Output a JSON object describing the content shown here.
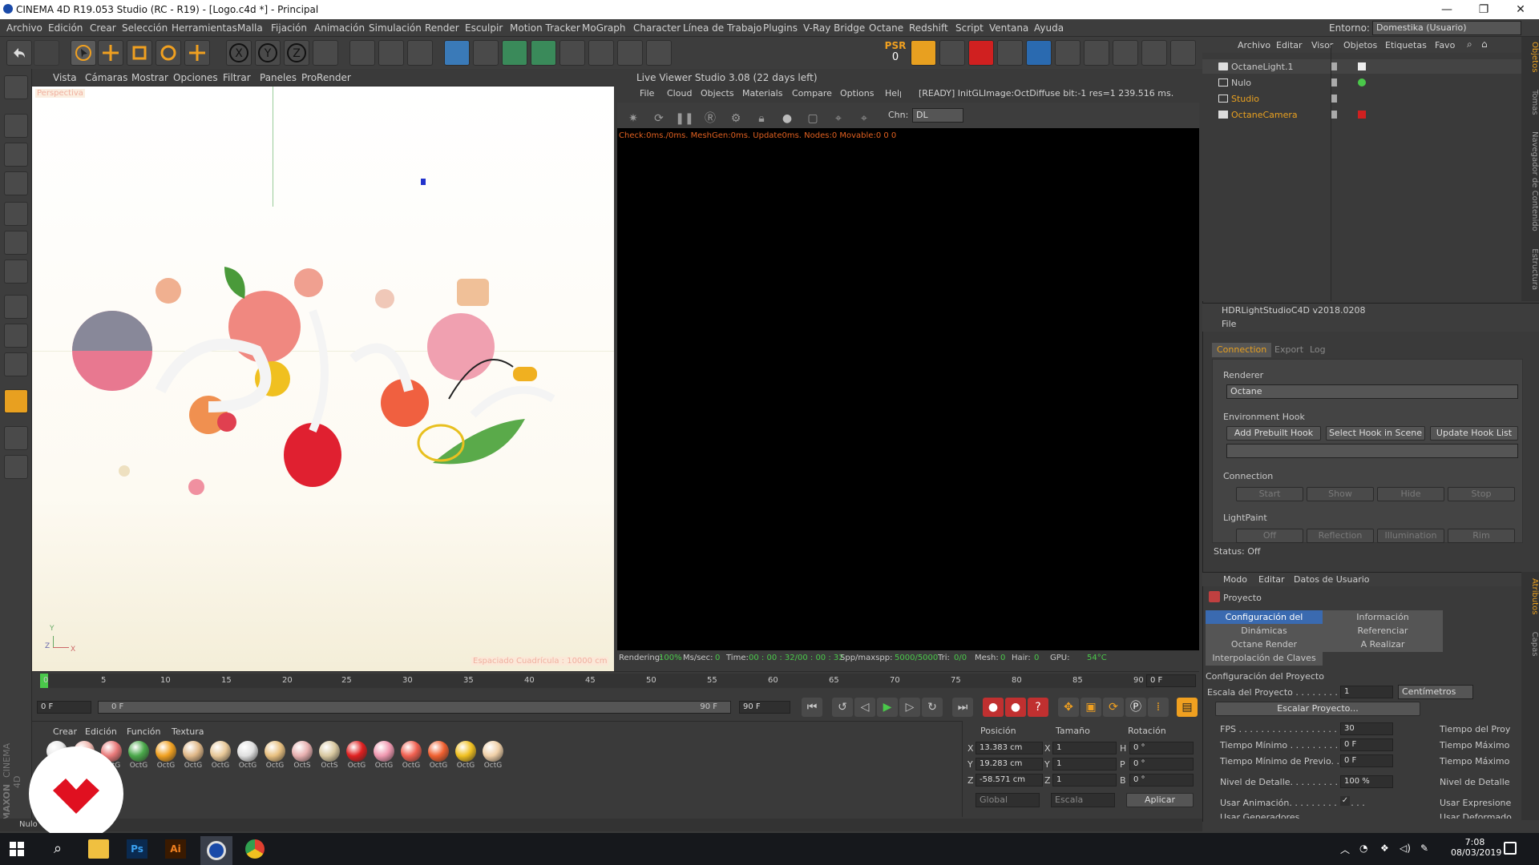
{
  "window": {
    "title": "CINEMA 4D R19.053 Studio (RC - R19) - [Logo.c4d *] - Principal",
    "minimize": "—",
    "maximize": "❐",
    "close": "✕"
  },
  "menubar": {
    "items": [
      "Archivo",
      "Edición",
      "Crear",
      "Selección",
      "Herramientas",
      "Malla",
      "Fijación",
      "Animación",
      "Simulación",
      "Render",
      "Esculpir",
      "Motion Tracker",
      "MoGraph",
      "Character",
      "Línea de Trabajo",
      "Plugins",
      "V-Ray Bridge",
      "Octane",
      "Redshift",
      "Script",
      "Ventana",
      "Ayuda"
    ],
    "env_label": "Entorno:",
    "env_value": "Domestika (Usuario)"
  },
  "toolbar": {
    "psr_label": "PSR",
    "psr_value": "0"
  },
  "viewport": {
    "menu": [
      "Vista",
      "Cámaras",
      "Mostrar",
      "Opciones",
      "Filtrar",
      "Paneles",
      "ProRender"
    ],
    "camera_label": "Perspectiva",
    "grid_label": "Espaciado Cuadrícula : 10000 cm",
    "axis_z": "Z",
    "axis_x": "X",
    "axis_y": "Y"
  },
  "liveviewer": {
    "title": "Live Viewer Studio 3.08 (22 days left)",
    "menu": [
      "File",
      "Cloud",
      "Objects",
      "Materials",
      "Compare",
      "Options",
      "Help"
    ],
    "status_msg": "[READY] InitGLImage:OctDiffuse  bit:-1 res=1  239.516 ms.",
    "chn_label": "Chn:",
    "chn_value": "DL",
    "check_line": "Check:0ms./0ms. MeshGen:0ms. Update0ms. Nodes:0 Movable:0  0 0",
    "bottom": {
      "rendering_label": "Rendering:",
      "rendering_value": "100%",
      "mssec_label": "Ms/sec:",
      "mssec_value": "0",
      "time_label": "Time:",
      "time_value": "00 : 00 : 32/00 : 00 : 32",
      "spp_label": "Spp/maxspp:",
      "spp_value": "5000/5000",
      "tri_label": "Tri:",
      "tri_value": "0/0",
      "mesh_label": "Mesh:",
      "mesh_value": "0",
      "hair_label": "Hair:",
      "hair_value": "0",
      "gpu_label": "GPU:",
      "gpu_value": "54°C"
    }
  },
  "objects": {
    "menu": [
      "Archivo",
      "Editar",
      "Visor",
      "Objetos",
      "Etiquetas",
      "Favo"
    ],
    "items": [
      {
        "name": "OctaneLight.1",
        "color": "#d0d0d0"
      },
      {
        "name": "Nulo",
        "color": "#d0d0d0"
      },
      {
        "name": "Studio",
        "color": "#e8a020"
      },
      {
        "name": "OctaneCamera",
        "color": "#e8a020"
      }
    ],
    "side_tabs": [
      "Objetos",
      "Tomas",
      "Navegador de Contenido",
      "Estructura"
    ]
  },
  "hdr": {
    "title": "HDRLightStudioC4D v2018.0208",
    "file_menu": "File",
    "tabs": [
      "Connection",
      "Export",
      "Log"
    ],
    "renderer_label": "Renderer",
    "renderer_value": "Octane",
    "env_hook_label": "Environment Hook",
    "hook_buttons": [
      "Add Prebuilt Hook",
      "Select Hook in Scene",
      "Update Hook List"
    ],
    "connection_label": "Connection",
    "connection_buttons": [
      "Start",
      "Show",
      "Hide",
      "Stop"
    ],
    "lightpaint_label": "LightPaint",
    "lightpaint_buttons": [
      "Off",
      "Reflection",
      "Illumination",
      "Rim"
    ],
    "status": "Status: Off"
  },
  "attributes": {
    "menu": [
      "Modo",
      "Editar",
      "Datos de Usuario"
    ],
    "proyecto": "Proyecto",
    "tabs": [
      "Configuración del Proyecto",
      "Información",
      "Dinámicas",
      "Referenciar",
      "Octane Render",
      "A Realizar",
      "Interpolación de Claves"
    ],
    "section_title": "Configuración del Proyecto",
    "escala_label": "Escala del Proyecto . . . . . . . . . .",
    "escala_value": "1",
    "escala_unit": "Centímetros",
    "escalar_button": "Escalar Proyecto...",
    "fps_label": "FPS . . . . . . . . . . . . . . . . . . . . . . .",
    "fps_value": "30",
    "tproy_label": "Tiempo del Proy",
    "tmin_label": "Tiempo Mínimo . . . . . . . . . . . . .",
    "tmin_value": "0 F",
    "tmax_label": "Tiempo Máximo",
    "tminprev_label": "Tiempo Mínimo de Previo. . . . . .",
    "tminprev_value": "0 F",
    "tmax2_label": "Tiempo Máximo",
    "nivel_label": "Nivel de Detalle. . . . . . . . . . . . .",
    "nivel_value": "100 %",
    "nivel2_label": "Nivel de Detalle",
    "usar_anim_label": "Usar Animación. . . . . . . . . . . . . .",
    "usar_expr_label": "Usar Expresione",
    "usar_gen_label": "Usar Generadores",
    "usar_def_label": "Usar Deformado",
    "side_tabs": [
      "Atributos",
      "Capas"
    ]
  },
  "timeline": {
    "ticks": [
      "0",
      "5",
      "10",
      "15",
      "20",
      "25",
      "30",
      "35",
      "40",
      "45",
      "50",
      "55",
      "60",
      "65",
      "70",
      "75",
      "80",
      "85",
      "90"
    ],
    "frame_end_field": "0 F",
    "start_field": "0 F",
    "range_left": "0 F",
    "range_right": "90 F",
    "end_field": "90 F"
  },
  "materials": {
    "menu": [
      "Crear",
      "Edición",
      "Función",
      "Textura"
    ],
    "items": [
      {
        "name": "OctG",
        "color": "#e8e8e8"
      },
      {
        "name": "OctG",
        "color": "#f0b8b0"
      },
      {
        "name": "OctG",
        "color": "#e87878"
      },
      {
        "name": "OctG",
        "color": "#4aa84a"
      },
      {
        "name": "OctG",
        "color": "#f0a020"
      },
      {
        "name": "OctG",
        "color": "#e0b888"
      },
      {
        "name": "OctG",
        "color": "#e8c898"
      },
      {
        "name": "OctG",
        "color": "#e0e0e0"
      },
      {
        "name": "OctG",
        "color": "#e8c080"
      },
      {
        "name": "OctS",
        "color": "#e8b0b0"
      },
      {
        "name": "OctS",
        "color": "#d8c8a0"
      },
      {
        "name": "OctG",
        "color": "#e02020"
      },
      {
        "name": "OctG",
        "color": "#f098b0"
      },
      {
        "name": "OctG",
        "color": "#f06050"
      },
      {
        "name": "OctG",
        "color": "#f06030"
      },
      {
        "name": "OctG",
        "color": "#f0c020"
      },
      {
        "name": "OctG",
        "color": "#f0d0a8"
      }
    ]
  },
  "coords": {
    "headers": [
      "Posición",
      "Tamaño",
      "Rotación"
    ],
    "rows": [
      {
        "axis": "X",
        "pos": "13.383 cm",
        "size": "1",
        "rlabel": "H",
        "rot": "0 °"
      },
      {
        "axis": "Y",
        "pos": "19.283 cm",
        "size": "1",
        "rlabel": "P",
        "rot": "0 °"
      },
      {
        "axis": "Z",
        "pos": "-58.571 cm",
        "size": "1",
        "rlabel": "B",
        "rot": "0 °"
      }
    ],
    "global": "Global",
    "escala": "Escala",
    "apply": "Aplicar"
  },
  "statusbar": {
    "text": "Nulo"
  },
  "brand": {
    "maxon": "MAXON",
    "c4d": "CINEMA 4D"
  },
  "taskbar": {
    "time": "7:08",
    "date": "08/03/2019"
  }
}
